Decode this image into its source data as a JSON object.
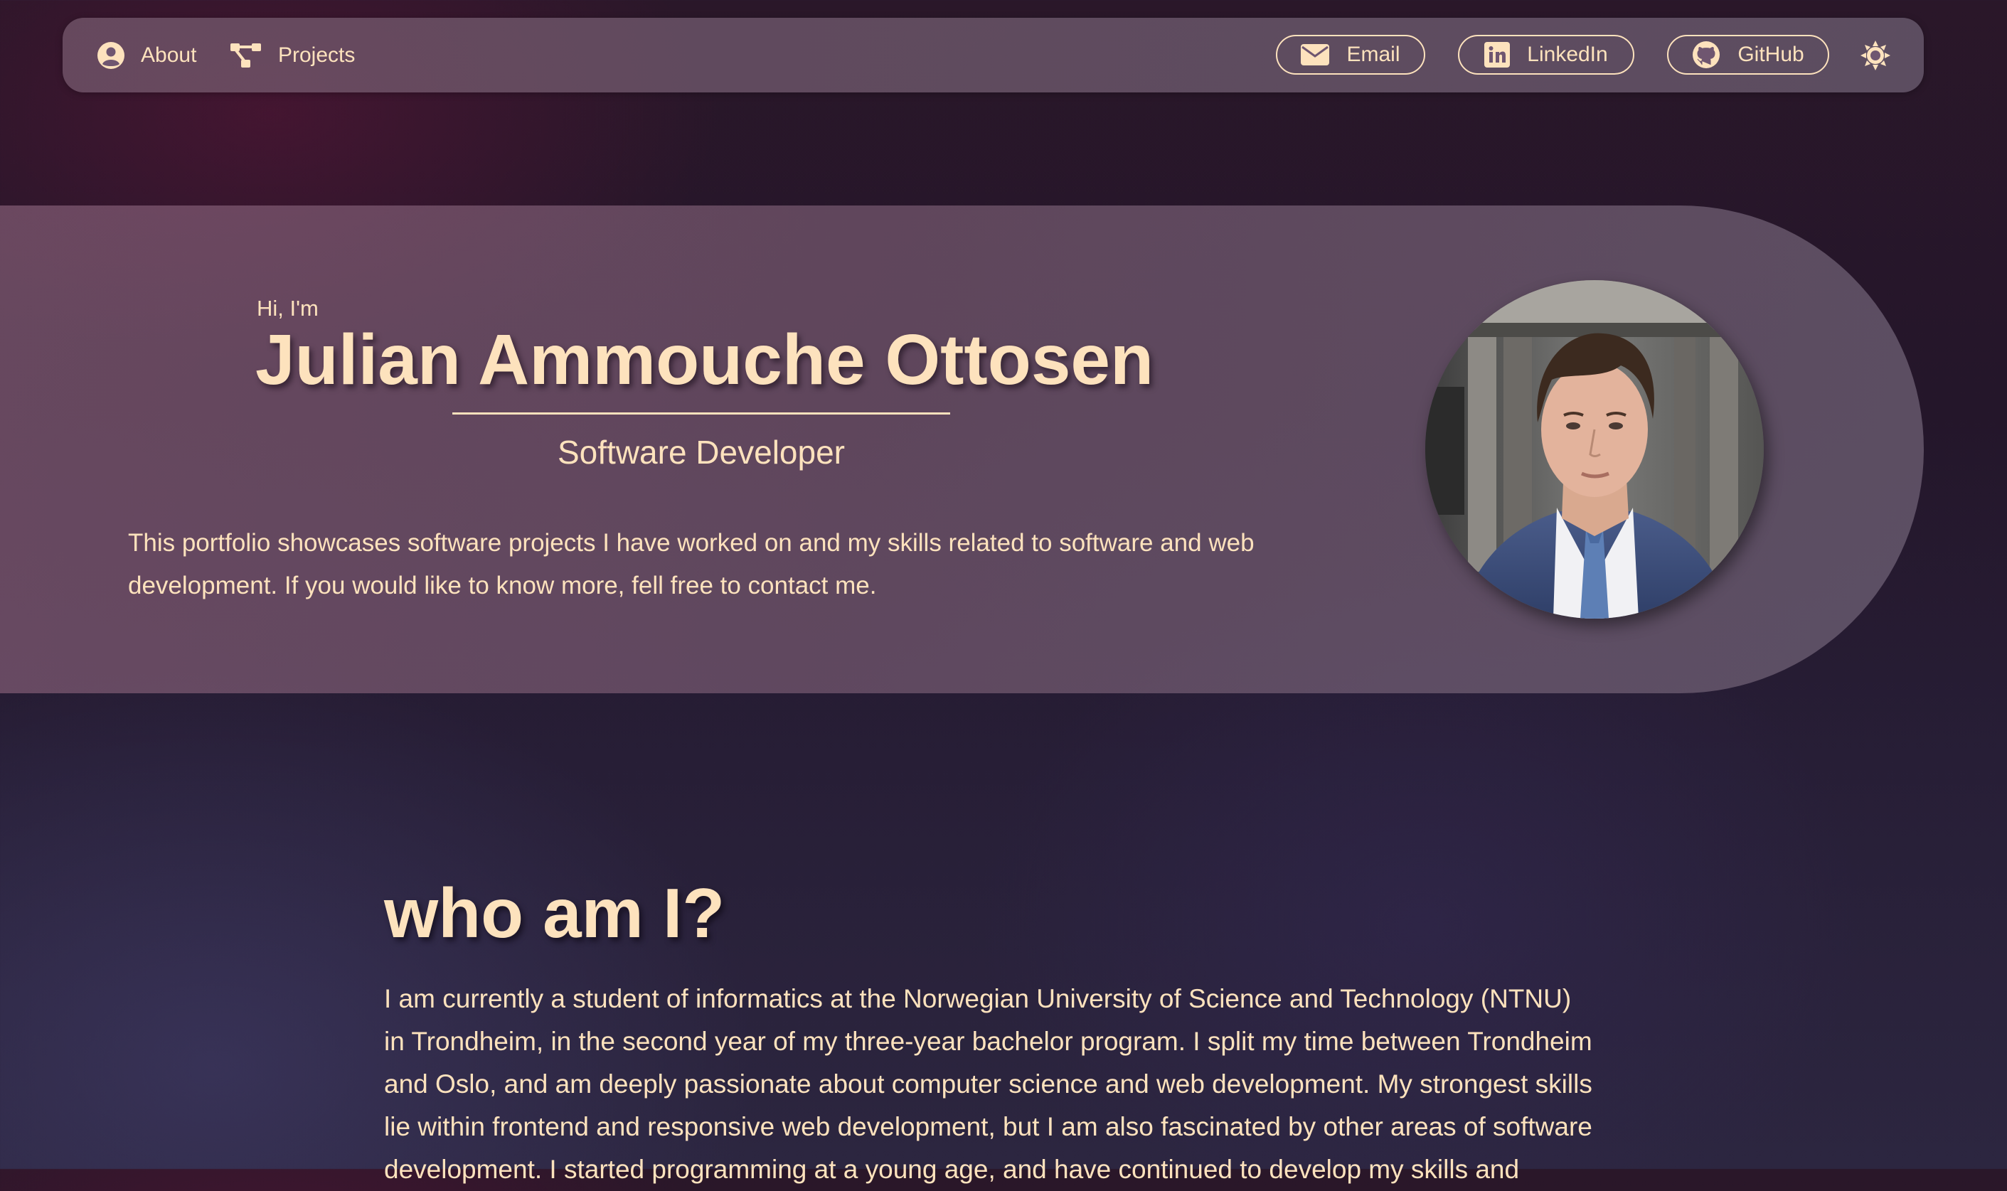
{
  "nav": {
    "about_label": "About",
    "projects_label": "Projects",
    "email_label": "Email",
    "linkedin_label": "LinkedIn",
    "github_label": "GitHub",
    "icons": {
      "about": "user-circle-icon",
      "projects": "project-diagram-icon",
      "email": "envelope-icon",
      "linkedin": "linkedin-icon",
      "github": "github-icon",
      "theme": "sun-icon"
    }
  },
  "hero": {
    "greeting": "Hi, I'm",
    "name": "Julian Ammouche Ottosen",
    "role": "Software Developer",
    "intro": "This portfolio showcases software projects I have worked on and my skills related to software and web development. If you would like to know more, fell free to contact me."
  },
  "about": {
    "title": "who am I?",
    "text": "I am currently a student of informatics at the Norwegian University of Science and Technology (NTNU) in Trondheim, in the second year of my three-year bachelor program. I split my time between Trondheim and Oslo, and am deeply passionate about computer science and web development. My strongest skills lie within frontend and responsive web development, but I am also fascinated by other areas of software development. I started programming at a young age, and have continued to develop my skills and"
  },
  "colors": {
    "accent": "#fde2bd",
    "background_top": "#2a1729",
    "background_bottom": "#2c2640",
    "card": "#7a5f76"
  }
}
